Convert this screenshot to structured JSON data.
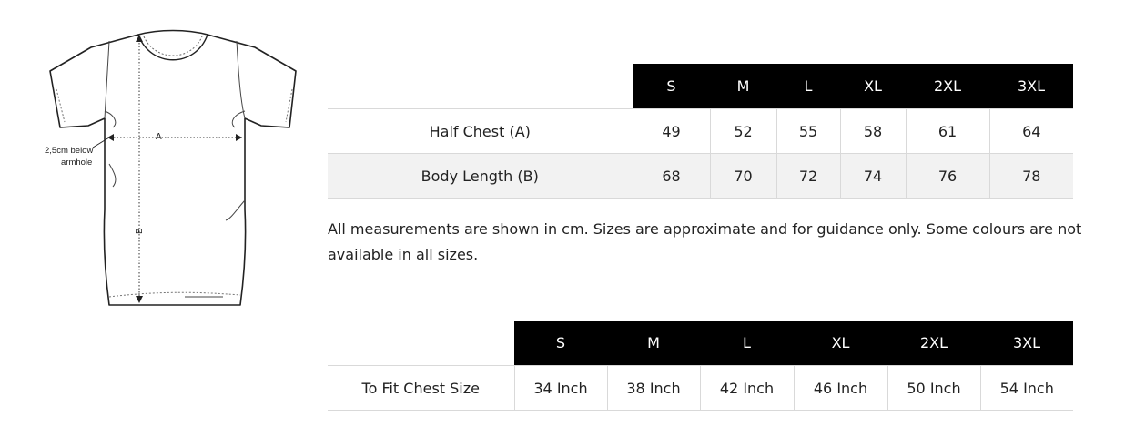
{
  "diagram": {
    "label_a": "A",
    "label_b": "B",
    "note_line1": "2,5cm below",
    "note_line2": "armhole"
  },
  "measurements_table": {
    "sizes": [
      "S",
      "M",
      "L",
      "XL",
      "2XL",
      "3XL"
    ],
    "rows": [
      {
        "label": "Half Chest (A)",
        "values": [
          "49",
          "52",
          "55",
          "58",
          "61",
          "64"
        ]
      },
      {
        "label": "Body Length (B)",
        "values": [
          "68",
          "70",
          "72",
          "74",
          "76",
          "78"
        ]
      }
    ]
  },
  "note": "All measurements are shown in cm. Sizes are approximate and for guidance only. Some colours are not available in all sizes.",
  "fit_table": {
    "sizes": [
      "S",
      "M",
      "L",
      "XL",
      "2XL",
      "3XL"
    ],
    "rows": [
      {
        "label": "To Fit Chest Size",
        "values": [
          "34 Inch",
          "38 Inch",
          "42 Inch",
          "46 Inch",
          "50 Inch",
          "54 Inch"
        ]
      }
    ]
  }
}
